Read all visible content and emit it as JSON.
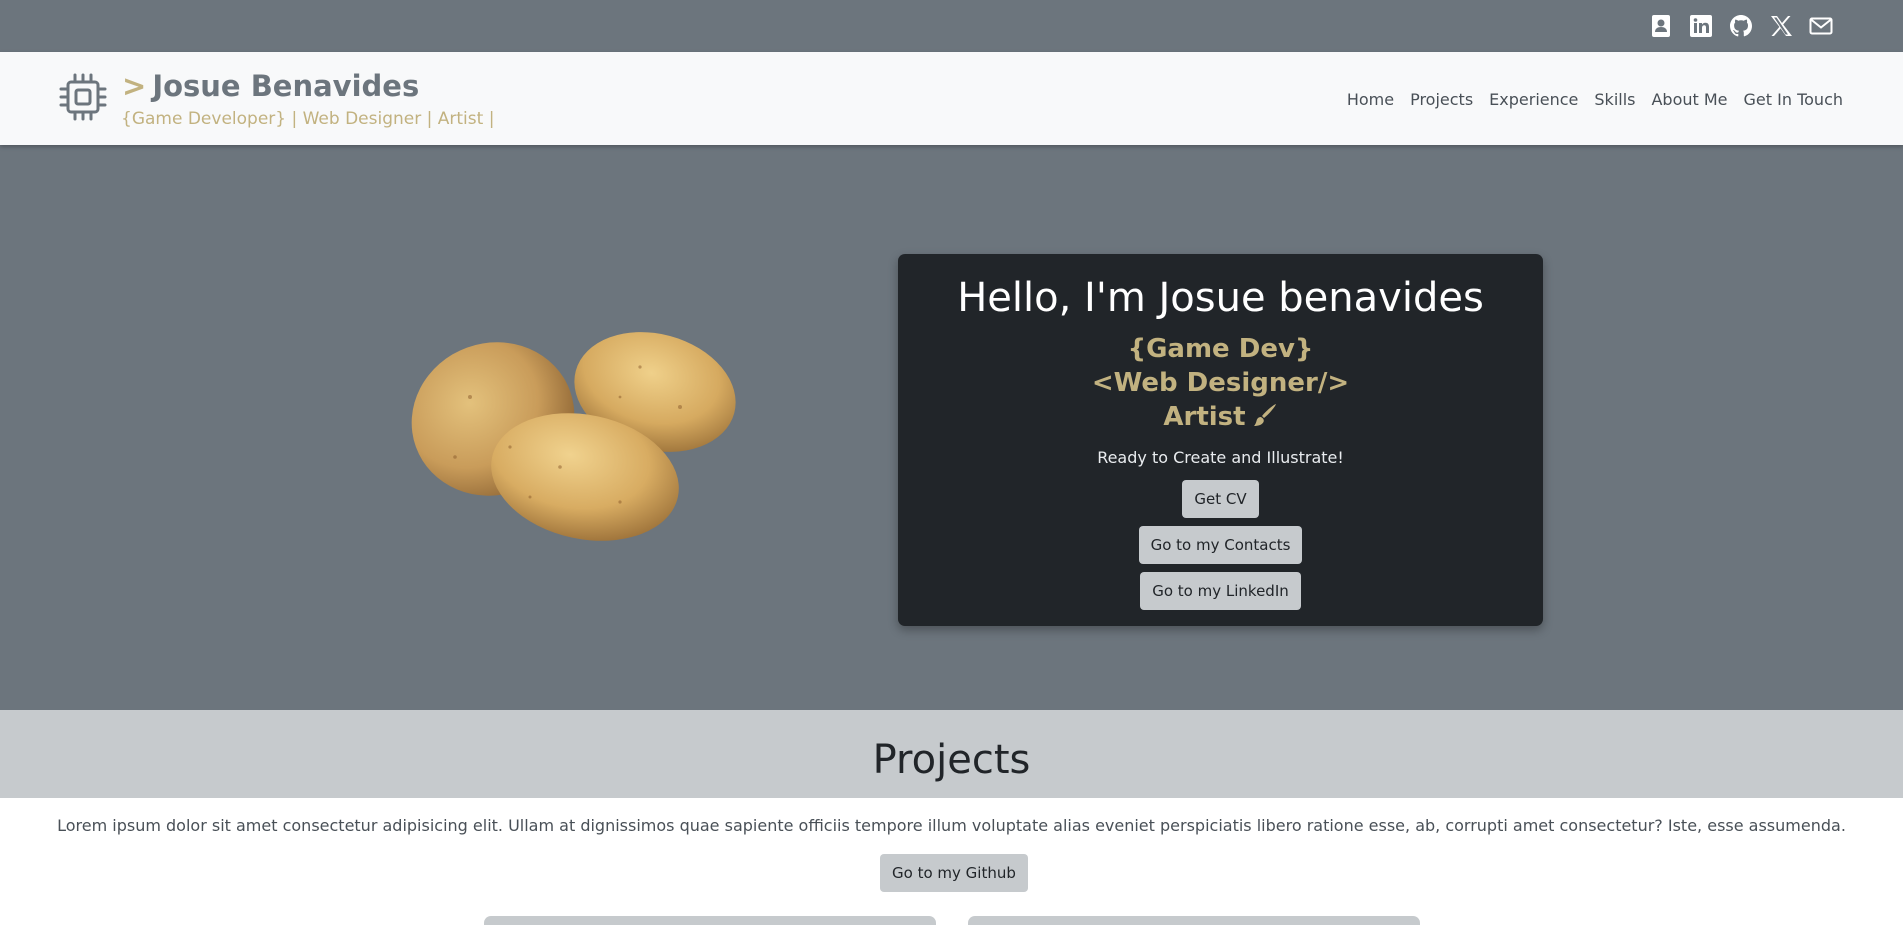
{
  "social": {
    "icons": [
      "contact-card-icon",
      "linkedin-icon",
      "github-icon",
      "x-icon",
      "mail-icon"
    ]
  },
  "brand": {
    "prompt": ">",
    "name": "Josue Benavides",
    "subtitle": "{Game Developer} | Web Designer | Artist |",
    "icon": "chip-icon"
  },
  "nav": {
    "items": [
      "Home",
      "Projects",
      "Experience",
      "Skills",
      "About Me",
      "Get In Touch"
    ]
  },
  "hero": {
    "title": "Hello, I'm Josue benavides",
    "roles": [
      "{Game Dev}",
      "<Web Designer/>",
      "Artist"
    ],
    "tagline": "Ready to Create and Illustrate!",
    "buttons": [
      "Get CV",
      "Go to my Contacts",
      "Go to my LinkedIn"
    ],
    "image": "potatoes-image"
  },
  "projects": {
    "heading": "Projects",
    "description": "Lorem ipsum dolor sit amet consectetur adipisicing elit. Ullam at dignissimos quae sapiente officiis tempore illum voluptate alias eveniet perspiciatis libero ratione esse, ab, corrupti amet consectetur? Iste, esse assumenda.",
    "github_button": "Go to my Github"
  },
  "colors": {
    "topbar": "#6c757d",
    "navbar": "#f8f9fa",
    "hero_bg": "#6c757d",
    "card_bg": "#212529",
    "accent": "#c2b280",
    "button_bg": "#c6cacd",
    "section_head": "#c6cacd"
  }
}
